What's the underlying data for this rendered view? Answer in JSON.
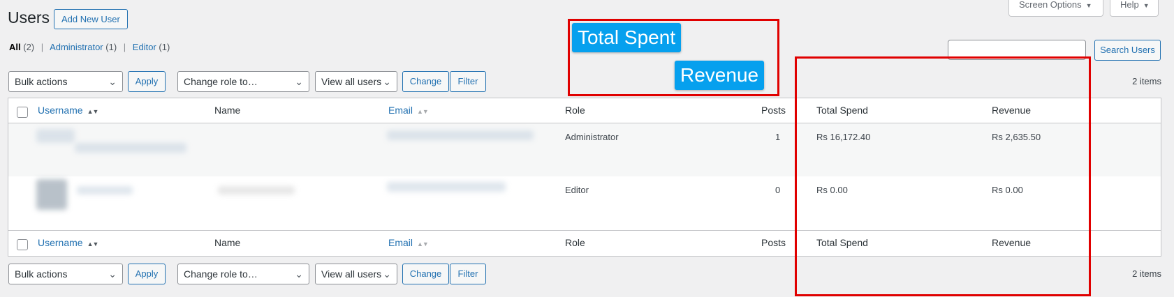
{
  "header": {
    "title": "Users",
    "add_new_label": "Add New User",
    "screen_options_label": "Screen Options",
    "help_label": "Help"
  },
  "filters": {
    "all_label": "All",
    "all_count": "(2)",
    "admin_label": "Administrator",
    "admin_count": "(1)",
    "editor_label": "Editor",
    "editor_count": "(1)"
  },
  "search": {
    "button_label": "Search Users",
    "value": ""
  },
  "tablenav": {
    "bulk_actions": "Bulk actions",
    "apply_label": "Apply",
    "change_role": "Change role to…",
    "view_all": "View all users",
    "change_label": "Change",
    "filter_label": "Filter",
    "items_count": "2 items"
  },
  "table": {
    "columns": [
      "Username",
      "Name",
      "Email",
      "Role",
      "Posts",
      "Total Spend",
      "Revenue"
    ],
    "rows": [
      {
        "role": "Administrator",
        "posts": "1",
        "total_spend": "Rs 16,172.40",
        "revenue": "Rs 2,635.50"
      },
      {
        "role": "Editor",
        "posts": "0",
        "total_spend": "Rs 0.00",
        "revenue": "Rs 0.00"
      }
    ]
  },
  "annotations": {
    "label1": "Total Spent",
    "label2": "Revenue",
    "box_color": "#e00000",
    "label_color": "#06a0ee"
  }
}
